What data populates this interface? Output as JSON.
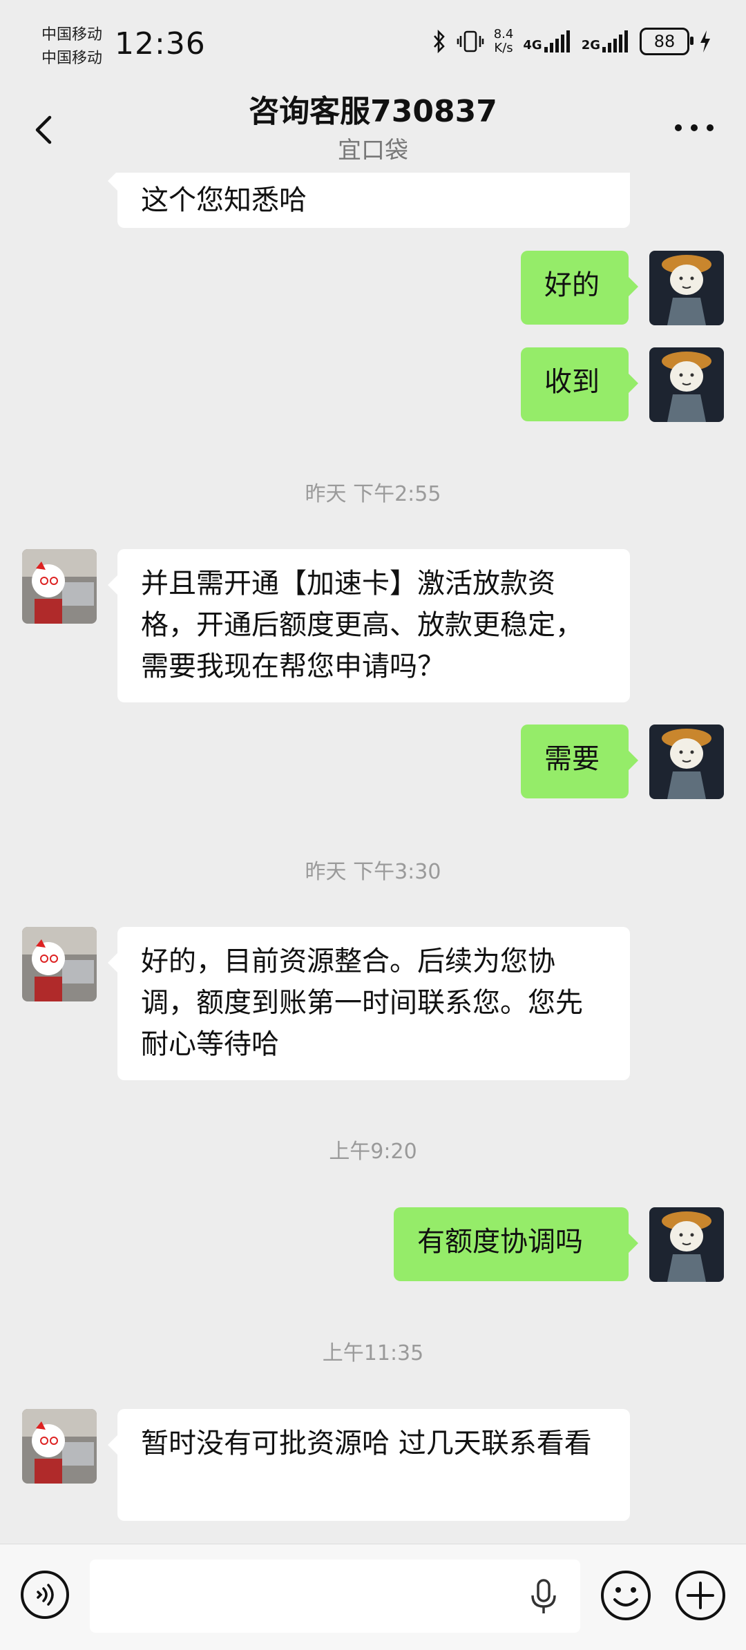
{
  "status": {
    "carrier_1": "中国移动",
    "carrier_2": "中国移动",
    "time": "12:36",
    "net_speed_value": "8.4",
    "net_speed_unit": "K/s",
    "network_1": "4G",
    "network_2": "2G",
    "battery": "88"
  },
  "header": {
    "title": "咨询客服730837",
    "subtitle": "宜口袋"
  },
  "messages": {
    "m0": "这个您知悉哈",
    "m1": "好的",
    "m2": "收到",
    "t1": "昨天 下午2:55",
    "m3": "并且需开通【加速卡】激活放款资格，开通后额度更高、放款更稳定，需要我现在帮您申请吗？",
    "m4": "需要",
    "t2": "昨天 下午3:30",
    "m5": "好的，目前资源整合。后续为您协调，额度到账第一时间联系您。您先耐心等待哈",
    "t3": "上午9:20",
    "m6": "有额度协调吗",
    "t4": "上午11:35",
    "m7": "暂时没有可批资源哈 过几天联系看看"
  },
  "colors": {
    "background": "#ededed",
    "own_bubble": "#95ec69",
    "other_bubble": "#ffffff"
  },
  "icons": {
    "back": "chevron-left-icon",
    "more": "more-dots-icon",
    "voice": "voice-icon",
    "mic": "microphone-icon",
    "emoji": "emoji-icon",
    "plus": "plus-icon"
  }
}
